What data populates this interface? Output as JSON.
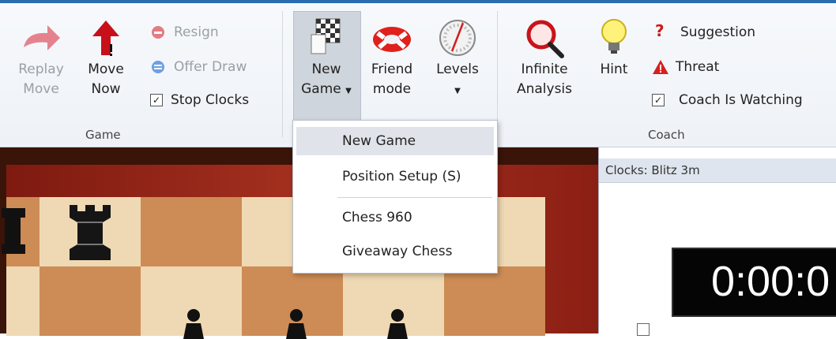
{
  "ribbon": {
    "game_group": {
      "label": "Game",
      "replay_move": {
        "line1": "Replay",
        "line2": "Move"
      },
      "move_now": {
        "line1": "Move",
        "line2": "Now"
      },
      "resign": "Resign",
      "offer_draw": "Offer Draw",
      "stop_clocks": "Stop Clocks",
      "stop_clocks_checked": true
    },
    "new_game": {
      "line1": "New",
      "line2": "Game"
    },
    "friend_mode": {
      "line1": "Friend",
      "line2": "mode"
    },
    "levels": {
      "line1": "Levels"
    },
    "coach_group": {
      "label": "Coach",
      "infinite_analysis": {
        "line1": "Infinite",
        "line2": "Analysis"
      },
      "hint": "Hint",
      "suggestion": "Suggestion",
      "threat": "Threat",
      "coach_is_watching": "Coach Is Watching",
      "coach_is_watching_checked": true
    }
  },
  "new_game_menu": {
    "items": [
      "New Game",
      "Position Setup (S)",
      "Chess 960",
      "Giveaway Chess"
    ],
    "highlighted": "New Game"
  },
  "clocks_panel": {
    "title": "Clocks: Blitz 3m",
    "time": "0:00:0"
  },
  "colors": {
    "accent": "#2b6cb0",
    "board_light": "#efd9b4",
    "board_dark": "#cd8c55",
    "frame": "#a4301f"
  }
}
